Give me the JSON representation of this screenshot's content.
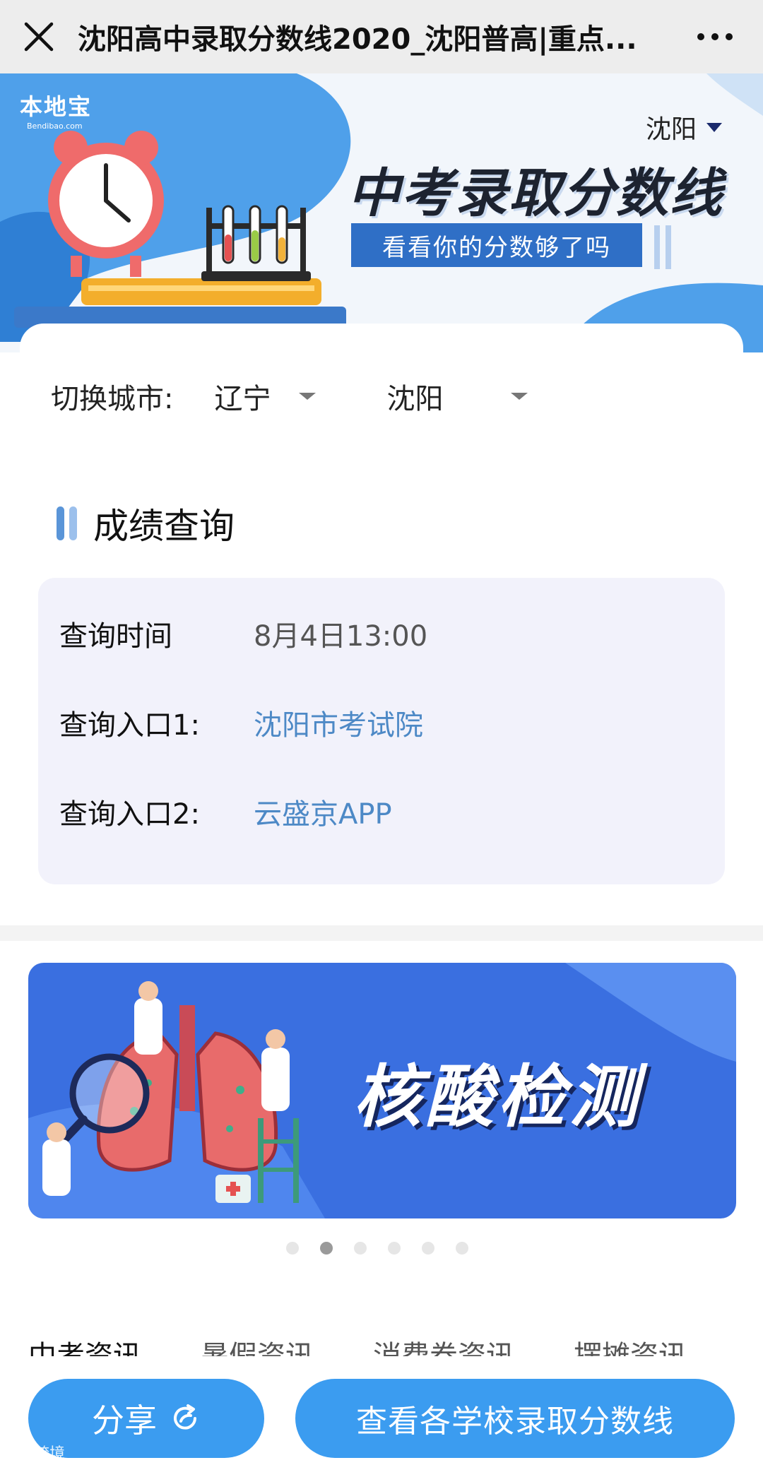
{
  "window": {
    "title": "沈阳高中录取分数线2020_沈阳普高|重点...",
    "close_icon": "close-icon",
    "more_icon": "more-horizontal-icon"
  },
  "banner": {
    "brand_name": "本地宝",
    "brand_sub": "Bendibao.com",
    "city": "沈阳",
    "headline": "中考录取分数线",
    "subline": "看看你的分数够了吗"
  },
  "city_switch": {
    "label": "切换城市:",
    "province": "辽宁",
    "city": "沈阳"
  },
  "score_query": {
    "title": "成绩查询",
    "rows": [
      {
        "label": "查询时间",
        "value": "8月4日13:00",
        "link": false
      },
      {
        "label": "查询入口1:",
        "value": "沈阳市考试院",
        "link": true
      },
      {
        "label": "查询入口2:",
        "value": "云盛京APP",
        "link": true
      }
    ]
  },
  "ad": {
    "title": "核酸检测",
    "slide_count": 6,
    "active_slide": 2
  },
  "news_tabs": [
    "中考资讯",
    "暑假资讯",
    "消费券资讯",
    "摆摊资讯"
  ],
  "bottom_bar": {
    "share_label": "分享",
    "main_label": "查看各学校录取分数线"
  },
  "watermark": "大数跨境",
  "colors": {
    "accent": "#3b9cf0",
    "link": "#4d89c6",
    "ad_bg": "#3a6fe0"
  }
}
